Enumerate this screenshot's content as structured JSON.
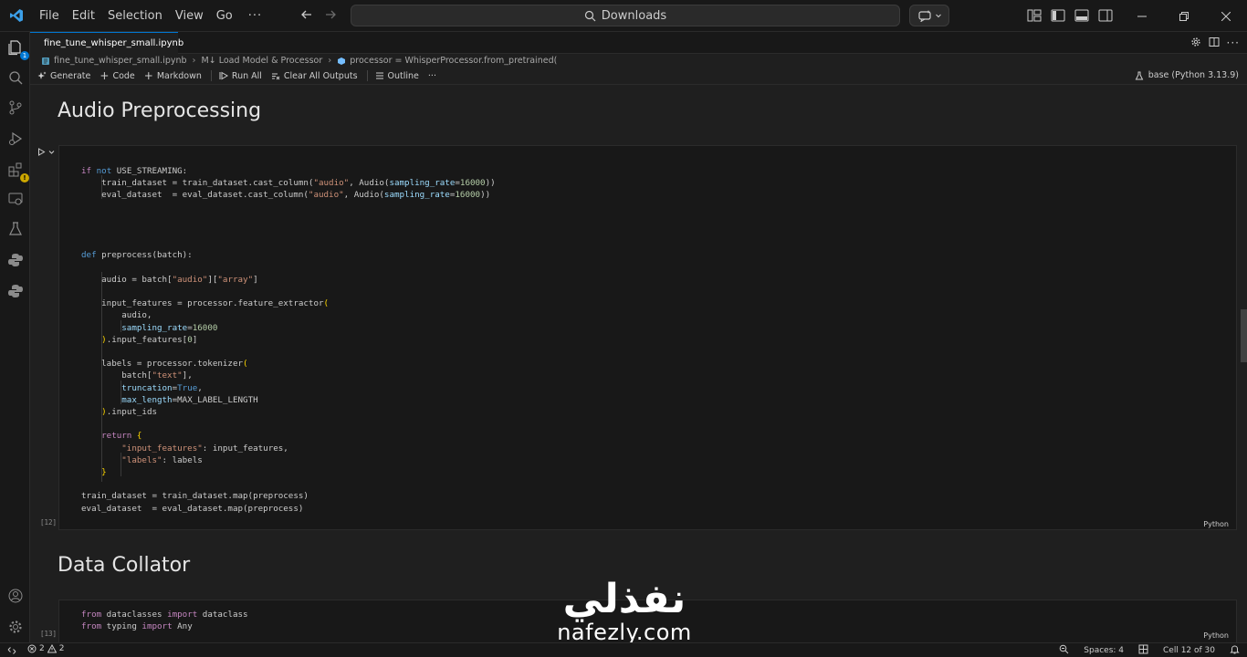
{
  "titlebar": {
    "menu": [
      "File",
      "Edit",
      "Selection",
      "View",
      "Go"
    ],
    "more": "···",
    "search_text": "Downloads"
  },
  "activity": {
    "explorer_badge": "1"
  },
  "tab": {
    "filename": "fine_tune_whisper_small.ipynb"
  },
  "breadcrumb": {
    "file": "fine_tune_whisper_small.ipynb",
    "section": "M↓ Load Model & Processor",
    "symbol": "processor = WhisperProcessor.from_pretrained("
  },
  "toolbar": {
    "generate": "Generate",
    "code": "Code",
    "markdown": "Markdown",
    "run_all": "Run All",
    "clear_outputs": "Clear All Outputs",
    "outline": "Outline",
    "more": "···",
    "kernel": "base (Python 3.13.9)"
  },
  "cells": {
    "heading1": "Audio Preprocessing",
    "cell12_count": "[12]",
    "cell12_lang": "Python",
    "heading2": "Data Collator",
    "cell13_count": "[13]",
    "cell13_lang": "Python"
  },
  "watermark": {
    "arabic": "نفذلي",
    "latin": "nafezly.com"
  },
  "statusbar": {
    "errors": "2",
    "warnings": "2",
    "spaces": "Spaces: 4",
    "cell_position": "Cell 12 of 30"
  }
}
